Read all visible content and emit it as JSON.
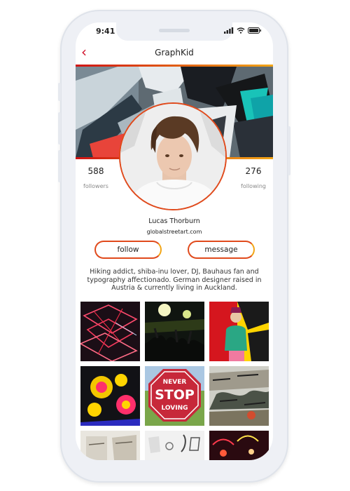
{
  "status": {
    "time": "9:41"
  },
  "nav": {
    "title": "GraphKid",
    "back_icon": "chevron-left-icon"
  },
  "profile": {
    "name": "Lucas Thorburn",
    "website": "globalstreetart.com",
    "followers_count": "588",
    "followers_label": "followers",
    "following_count": "276",
    "following_label": "following"
  },
  "actions": {
    "follow": "follow",
    "message": "message"
  },
  "bio": "Hiking addict, shiba-inu lover, DJ, Bauhaus fan and typography affectionado. German designer raised in Austria & currently living in Auckland.",
  "gallery": {
    "stop_sign_line1": "NEVER",
    "stop_sign_line2": "STOP",
    "stop_sign_line3": "LOVING"
  },
  "colors": {
    "accent_red": "#d0102a",
    "accent_orange": "#f2a516"
  }
}
